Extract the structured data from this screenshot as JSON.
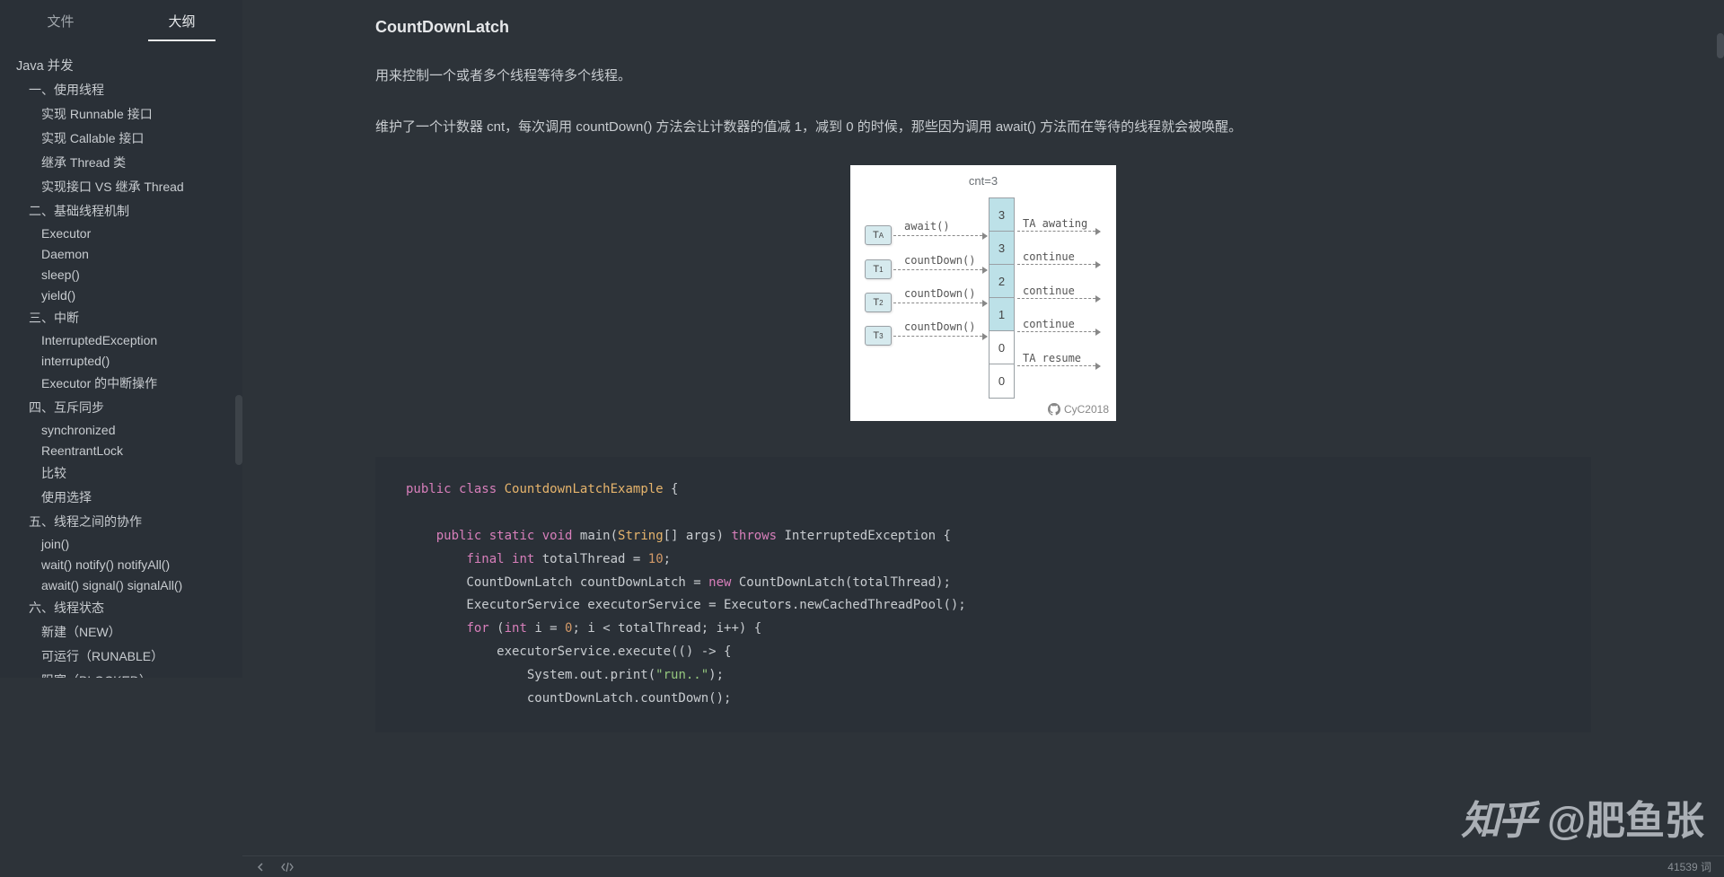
{
  "tabs": {
    "file": "文件",
    "outline": "大纲",
    "active": "outline"
  },
  "outline": {
    "items": [
      {
        "level": 0,
        "text": "Java 并发"
      },
      {
        "level": 1,
        "text": "一、使用线程"
      },
      {
        "level": 2,
        "text": "实现 Runnable 接口"
      },
      {
        "level": 2,
        "text": "实现 Callable 接口"
      },
      {
        "level": 2,
        "text": "继承 Thread 类"
      },
      {
        "level": 2,
        "text": "实现接口 VS 继承 Thread"
      },
      {
        "level": 1,
        "text": "二、基础线程机制"
      },
      {
        "level": 2,
        "text": "Executor"
      },
      {
        "level": 2,
        "text": "Daemon"
      },
      {
        "level": 2,
        "text": "sleep()"
      },
      {
        "level": 2,
        "text": "yield()"
      },
      {
        "level": 1,
        "text": "三、中断"
      },
      {
        "level": 2,
        "text": "InterruptedException"
      },
      {
        "level": 2,
        "text": "interrupted()"
      },
      {
        "level": 2,
        "text": "Executor 的中断操作"
      },
      {
        "level": 1,
        "text": "四、互斥同步"
      },
      {
        "level": 2,
        "text": "synchronized"
      },
      {
        "level": 2,
        "text": "ReentrantLock"
      },
      {
        "level": 2,
        "text": "比较"
      },
      {
        "level": 2,
        "text": "使用选择"
      },
      {
        "level": 1,
        "text": "五、线程之间的协作"
      },
      {
        "level": 2,
        "text": "join()"
      },
      {
        "level": 2,
        "text": "wait() notify() notifyAll()"
      },
      {
        "level": 2,
        "text": "await() signal() signalAll()"
      },
      {
        "level": 1,
        "text": "六、线程状态"
      },
      {
        "level": 2,
        "text": "新建（NEW）"
      },
      {
        "level": 2,
        "text": "可运行（RUNABLE）"
      },
      {
        "level": 2,
        "text": "阻塞（BLOCKED）"
      }
    ]
  },
  "article": {
    "title": "CountDownLatch",
    "p1": "用来控制一个或者多个线程等待多个线程。",
    "p2": "维护了一个计数器 cnt，每次调用 countDown() 方法会让计数器的值减 1，减到 0 的时候，那些因为调用 await() 方法而在等待的线程就会被唤醒。"
  },
  "diagram": {
    "cnt_label": "cnt=3",
    "stack_values": [
      "3",
      "3",
      "2",
      "1",
      "0",
      "0"
    ],
    "highlighted": [
      0,
      1,
      2,
      3
    ],
    "threads": [
      "TA",
      "T1",
      "T2",
      "T3"
    ],
    "left_labels": [
      "await()",
      "countDown()",
      "countDown()",
      "countDown()"
    ],
    "right_labels": [
      "TA awating",
      "continue",
      "continue",
      "continue",
      "TA resume"
    ],
    "credit": "CyC2018"
  },
  "code": {
    "l1_a": "public",
    "l1_b": "class",
    "l1_c": "CountdownLatchExample",
    "l1_d": " {",
    "l2_a": "public",
    "l2_b": "static",
    "l2_c": "void",
    "l2_d": " main(",
    "l2_e": "String",
    "l2_f": "[] args) ",
    "l2_g": "throws",
    "l2_h": " InterruptedException {",
    "l3_a": "final",
    "l3_b": "int",
    "l3_c": " totalThread = ",
    "l3_d": "10",
    "l3_e": ";",
    "l4": "        CountDownLatch countDownLatch = ",
    "l4_a": "new",
    "l4_b": " CountDownLatch(totalThread);",
    "l5": "        ExecutorService executorService = Executors.newCachedThreadPool();",
    "l6_a": "for",
    "l6_b": " (",
    "l6_c": "int",
    "l6_d": " i = ",
    "l6_e": "0",
    "l6_f": "; i < totalThread; i++) {",
    "l7": "            executorService.execute(() -> {",
    "l8_a": "                System.out.print(",
    "l8_b": "\"run..\"",
    "l8_c": ");",
    "l9": "                countDownLatch.countDown();"
  },
  "status": {
    "word_count": "41539 词"
  },
  "watermark": {
    "logo": "知乎",
    "text": "@肥鱼张"
  }
}
